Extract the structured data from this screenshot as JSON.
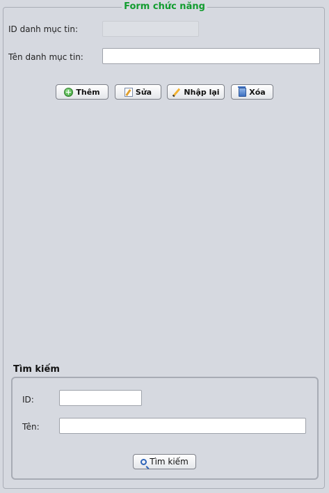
{
  "form": {
    "title": "Form chức năng",
    "id_label": "ID danh mục tin:",
    "id_value": "",
    "name_label": "Tên danh mục tin:",
    "name_value": ""
  },
  "buttons": {
    "add": "Thêm",
    "edit": "Sửa",
    "reset": "Nhập lại",
    "delete": "Xóa"
  },
  "search": {
    "title": "Tìm kiếm",
    "id_label": "ID:",
    "id_value": "",
    "name_label": "Tên:",
    "name_value": "",
    "button": "Tìm kiếm"
  },
  "colors": {
    "legend": "#129c2f",
    "background": "#d6d9e0"
  }
}
